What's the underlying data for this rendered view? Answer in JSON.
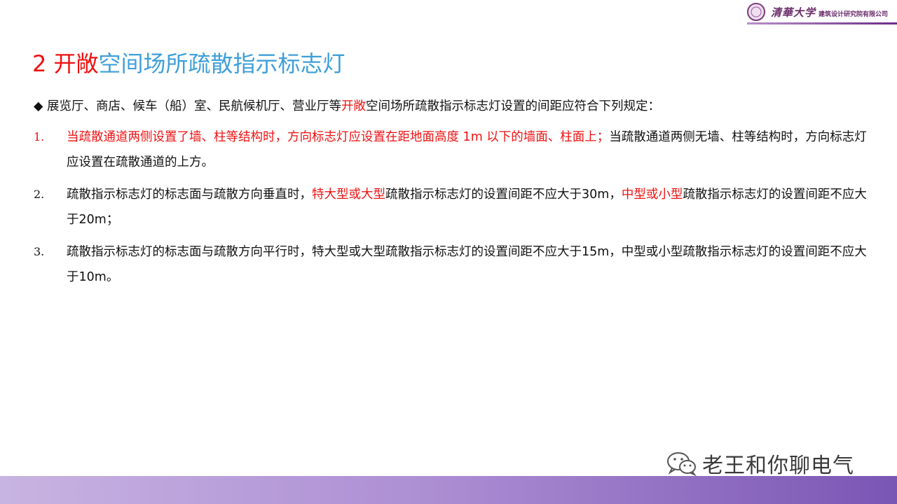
{
  "header": {
    "brand_script": "清華大学",
    "org_name": "建筑设计研究院有限公司"
  },
  "title": {
    "number": "2",
    "highlight": "开敞",
    "rest": "空间场所疏散指示标志灯"
  },
  "intro": {
    "bullet": "◆",
    "text_a": "展览厅、商店、候车（船）室、民航候机厅、营业厅等",
    "highlight": "开敞",
    "text_b": "空间场所疏散指示标志灯设置的间距应符合下列规定："
  },
  "items": [
    {
      "num": "1.",
      "red_text": "当疏散通道两侧设置了墙、柱等结构时，方向标志灯应设置在距地面高度 1m 以下的墙面、柱面上；",
      "text": "当疏散通道两侧无墙、柱等结构时，方向标志灯应设置在疏散通道的上方。"
    },
    {
      "num": "2.",
      "text_a": "疏散指示标志灯的标志面与疏散方向垂直时，",
      "red_a": "特大型或大型",
      "text_b": "疏散指示标志灯的设置间距不应大于30m，",
      "red_b": "中型或小型",
      "text_c": "疏散指示标志灯的设置间距不应大于20m；"
    },
    {
      "num": "3.",
      "text": "疏散指示标志灯的标志面与疏散方向平行时，特大型或大型疏散指示标志灯的设置间距不应大于15m，中型或小型疏散指示标志灯的设置间距不应大于10m。"
    }
  ],
  "watermark": {
    "text": "老王和你聊电气"
  },
  "colors": {
    "title_red": "#ee1111",
    "title_blue": "#3f9fd9",
    "footer_band": "#ab8cd2"
  }
}
